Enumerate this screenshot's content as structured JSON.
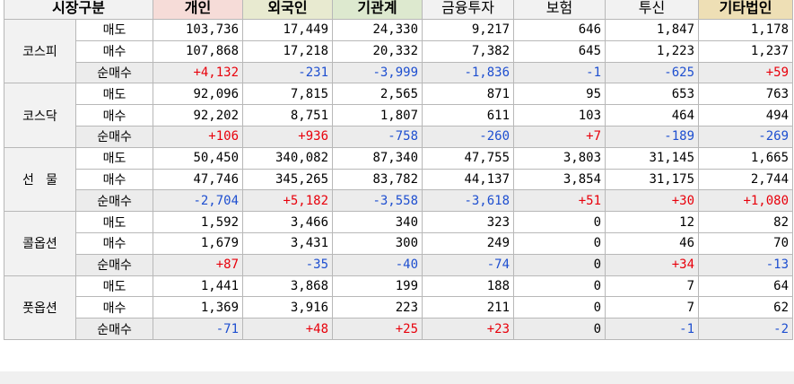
{
  "headers": [
    "시장구분",
    "개인",
    "외국인",
    "기관계",
    "금융투자",
    "보험",
    "투신",
    "기타법인"
  ],
  "markets": [
    {
      "name": "코스피",
      "rows": [
        {
          "kind": "매도",
          "values": [
            "103,736",
            "17,449",
            "24,330",
            "9,217",
            "646",
            "1,847",
            "1,178"
          ],
          "signs": [
            0,
            0,
            0,
            0,
            0,
            0,
            0
          ]
        },
        {
          "kind": "매수",
          "values": [
            "107,868",
            "17,218",
            "20,332",
            "7,382",
            "645",
            "1,223",
            "1,237"
          ],
          "signs": [
            0,
            0,
            0,
            0,
            0,
            0,
            0
          ]
        },
        {
          "kind": "순매수",
          "values": [
            "+4,132",
            "-231",
            "-3,999",
            "-1,836",
            "-1",
            "-625",
            "+59"
          ],
          "signs": [
            1,
            -1,
            -1,
            -1,
            -1,
            -1,
            1
          ]
        }
      ]
    },
    {
      "name": "코스닥",
      "rows": [
        {
          "kind": "매도",
          "values": [
            "92,096",
            "7,815",
            "2,565",
            "871",
            "95",
            "653",
            "763"
          ],
          "signs": [
            0,
            0,
            0,
            0,
            0,
            0,
            0
          ]
        },
        {
          "kind": "매수",
          "values": [
            "92,202",
            "8,751",
            "1,807",
            "611",
            "103",
            "464",
            "494"
          ],
          "signs": [
            0,
            0,
            0,
            0,
            0,
            0,
            0
          ]
        },
        {
          "kind": "순매수",
          "values": [
            "+106",
            "+936",
            "-758",
            "-260",
            "+7",
            "-189",
            "-269"
          ],
          "signs": [
            1,
            1,
            -1,
            -1,
            1,
            -1,
            -1
          ]
        }
      ]
    },
    {
      "name": "선   물",
      "rows": [
        {
          "kind": "매도",
          "values": [
            "50,450",
            "340,082",
            "87,340",
            "47,755",
            "3,803",
            "31,145",
            "1,665"
          ],
          "signs": [
            0,
            0,
            0,
            0,
            0,
            0,
            0
          ]
        },
        {
          "kind": "매수",
          "values": [
            "47,746",
            "345,265",
            "83,782",
            "44,137",
            "3,854",
            "31,175",
            "2,744"
          ],
          "signs": [
            0,
            0,
            0,
            0,
            0,
            0,
            0
          ]
        },
        {
          "kind": "순매수",
          "values": [
            "-2,704",
            "+5,182",
            "-3,558",
            "-3,618",
            "+51",
            "+30",
            "+1,080"
          ],
          "signs": [
            -1,
            1,
            -1,
            -1,
            1,
            1,
            1
          ]
        }
      ]
    },
    {
      "name": "콜옵션",
      "rows": [
        {
          "kind": "매도",
          "values": [
            "1,592",
            "3,466",
            "340",
            "323",
            "0",
            "12",
            "82"
          ],
          "signs": [
            0,
            0,
            0,
            0,
            0,
            0,
            0
          ]
        },
        {
          "kind": "매수",
          "values": [
            "1,679",
            "3,431",
            "300",
            "249",
            "0",
            "46",
            "70"
          ],
          "signs": [
            0,
            0,
            0,
            0,
            0,
            0,
            0
          ]
        },
        {
          "kind": "순매수",
          "values": [
            "+87",
            "-35",
            "-40",
            "-74",
            "0",
            "+34",
            "-13"
          ],
          "signs": [
            1,
            -1,
            -1,
            -1,
            0,
            1,
            -1
          ]
        }
      ]
    },
    {
      "name": "풋옵션",
      "rows": [
        {
          "kind": "매도",
          "values": [
            "1,441",
            "3,868",
            "199",
            "188",
            "0",
            "7",
            "64"
          ],
          "signs": [
            0,
            0,
            0,
            0,
            0,
            0,
            0
          ]
        },
        {
          "kind": "매수",
          "values": [
            "1,369",
            "3,916",
            "223",
            "211",
            "0",
            "7",
            "62"
          ],
          "signs": [
            0,
            0,
            0,
            0,
            0,
            0,
            0
          ]
        },
        {
          "kind": "순매수",
          "values": [
            "-71",
            "+48",
            "+25",
            "+23",
            "0",
            "-1",
            "-2"
          ],
          "signs": [
            -1,
            1,
            1,
            1,
            0,
            -1,
            -1
          ]
        }
      ]
    }
  ],
  "colors": {
    "positive": "#e8000b",
    "negative": "#1e4fd0",
    "header_individual": "#f6dcd8",
    "header_foreign": "#e8ead0",
    "header_institution": "#dde9cf",
    "header_other": "#eedfb5",
    "net_row_bg": "#ececec"
  }
}
